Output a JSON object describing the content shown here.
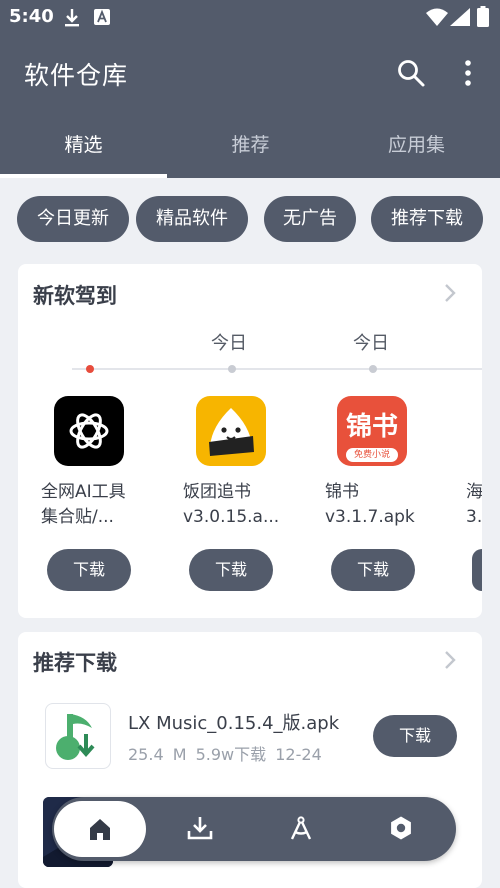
{
  "status": {
    "time": "5:40",
    "icons": [
      "download-icon",
      "font-a-icon",
      "wifi-icon",
      "signal-icon",
      "battery-icon"
    ]
  },
  "appbar": {
    "title": "软件仓库",
    "actions": [
      "search-icon",
      "more-vert-icon"
    ]
  },
  "tabs": [
    {
      "label": "精选",
      "active": true
    },
    {
      "label": "推荐",
      "active": false
    },
    {
      "label": "应用集",
      "active": false
    }
  ],
  "chips": [
    "今日更新",
    "精品软件",
    "无广告",
    "推荐下载"
  ],
  "new_section": {
    "title": "新软驾到",
    "day_labels": [
      "今日",
      "今日"
    ],
    "apps": [
      {
        "name": "全网AI工具集合贴/...",
        "line1": "全网AI工具",
        "line2": "集合贴/...",
        "button": "下载",
        "icon": "openai-logo-icon"
      },
      {
        "name": "饭团追书 v3.0.15.a...",
        "line1": "饭团追书",
        "line2": "v3.0.15.a...",
        "button": "下载",
        "icon": "rice-ball-book-icon"
      },
      {
        "name": "锦书 v3.1.7.apk",
        "line1": "锦书",
        "line2": "v3.1.7.apk",
        "button": "下载",
        "icon": "jinshu-logo-icon",
        "icon_text": "锦书",
        "icon_subtext": "免费小说"
      },
      {
        "line1": "海",
        "line2": "3."
      }
    ]
  },
  "recommend_section": {
    "title": "推荐下载",
    "items": [
      {
        "name": "LX Music_0.15.4_版.apk",
        "size": "25.4 M",
        "downloads": "5.9w下载",
        "date": "12-24",
        "button": "下载",
        "icon": "lx-music-icon"
      }
    ]
  },
  "bottom_nav": {
    "items": [
      "home-icon",
      "download-tray-icon",
      "compass-icon",
      "settings-icon"
    ],
    "active": 0
  },
  "colors": {
    "primary": "#535b6b",
    "background": "#eef0f4",
    "card": "#ffffff",
    "accent_dot": "#e74c3c",
    "openai_bg": "#000000",
    "fantuan_bg": "#f7b500",
    "jinshu_bg": "#e8513b",
    "lx_green": "#4caf6e"
  }
}
